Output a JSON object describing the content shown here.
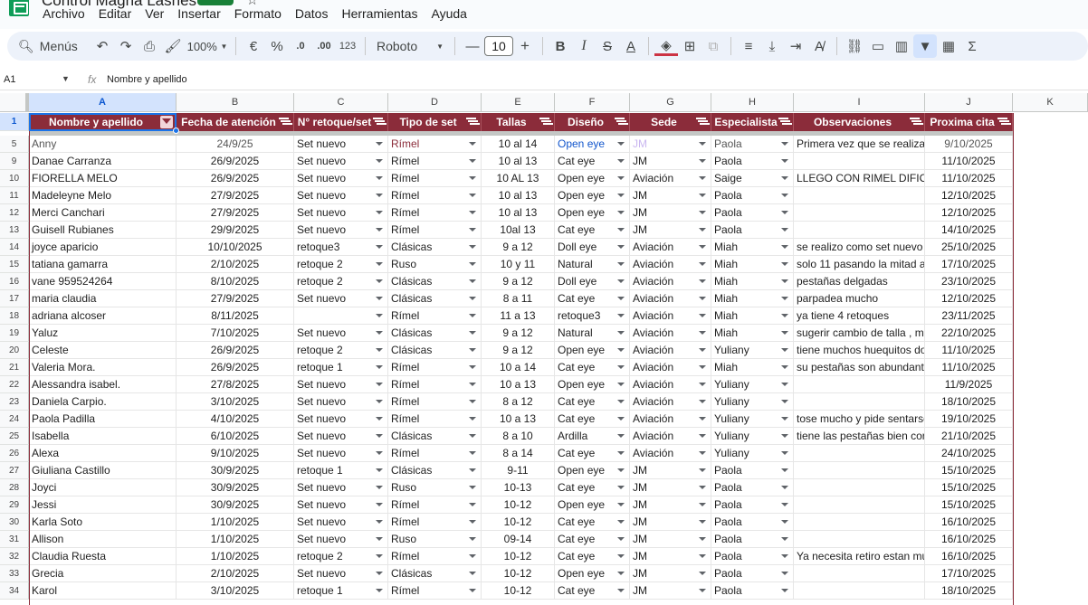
{
  "app": {
    "title": "Control Magna Lashes",
    "menu": [
      "Archivo",
      "Editar",
      "Ver",
      "Insertar",
      "Formato",
      "Datos",
      "Herramientas",
      "Ayuda"
    ]
  },
  "toolbar": {
    "search_label": "Menús",
    "zoom": "100%",
    "currency": "€",
    "percent": "%",
    "dec_decrease": ".0",
    "dec_increase": ".00",
    "number_format": "123",
    "font": "Roboto",
    "font_size": "10",
    "minus": "—",
    "plus": "+"
  },
  "formula_bar": {
    "cell_ref": "A1",
    "fx": "fx",
    "content": "Nombre y apellido"
  },
  "columns": [
    {
      "letter": "A",
      "header": "Nombre y apellido",
      "filter_active": true
    },
    {
      "letter": "B",
      "header": "Fecha de atención",
      "filter_active": false
    },
    {
      "letter": "C",
      "header": "N° retoque/set",
      "filter_active": false
    },
    {
      "letter": "D",
      "header": "Tipo de set",
      "filter_active": false
    },
    {
      "letter": "E",
      "header": "Tallas",
      "filter_active": false
    },
    {
      "letter": "F",
      "header": "Diseño",
      "filter_active": false
    },
    {
      "letter": "G",
      "header": "Sede",
      "filter_active": false
    },
    {
      "letter": "H",
      "header": "Especialista",
      "filter_active": false
    },
    {
      "letter": "I",
      "header": "Observaciones",
      "filter_active": false
    },
    {
      "letter": "J",
      "header": "Proxima cita",
      "filter_active": false
    },
    {
      "letter": "K",
      "header": "",
      "filter_active": false
    }
  ],
  "header_row_number": "1",
  "rows": [
    {
      "n": "5",
      "cells": [
        "Anny",
        "24/9/25",
        "Set nuevo",
        "Rímel",
        "10 al 14",
        "Open eye",
        "JM",
        "Paola",
        "Primera vez que se realiza",
        "9/10/2025"
      ]
    },
    {
      "n": "9",
      "cells": [
        "Danae Carranza",
        "26/9/2025",
        "Set nuevo",
        "Rímel",
        "10 al 13",
        "Cat eye",
        "JM",
        "Paola",
        "",
        "11/10/2025"
      ]
    },
    {
      "n": "10",
      "cells": [
        "FIORELLA MELO",
        "26/9/2025",
        "Set nuevo",
        "Rímel",
        "10 AL 13",
        "Open eye",
        "Aviación",
        "Saige",
        "LLEGO CON RIMEL DIFIC",
        "11/10/2025"
      ]
    },
    {
      "n": "11",
      "cells": [
        "Madeleyne Melo",
        "27/9/2025",
        "Set nuevo",
        "Rímel",
        "10 al 13",
        "Open eye",
        "JM",
        "Paola",
        "",
        "12/10/2025"
      ]
    },
    {
      "n": "12",
      "cells": [
        "Merci Canchari",
        "27/9/2025",
        "Set nuevo",
        "Rímel",
        "10 al 13",
        "Open eye",
        "JM",
        "Paola",
        "",
        "12/10/2025"
      ]
    },
    {
      "n": "13",
      "cells": [
        "Guisell Rubianes",
        "29/9/2025",
        "Set nuevo",
        "Rímel",
        "10al 13",
        "Cat eye",
        "JM",
        "Paola",
        "",
        "14/10/2025"
      ]
    },
    {
      "n": "14",
      "cells": [
        "joyce aparicio",
        "10/10/2025",
        "retoque3",
        "Clásicas",
        "9 a 12",
        "Doll eye",
        "Aviación",
        "Miah",
        "se realizo como set nuevo",
        "25/10/2025"
      ]
    },
    {
      "n": "15",
      "cells": [
        "tatiana gamarra",
        "2/10/2025",
        "retoque 2",
        "Ruso",
        "10 y 11",
        "Natural",
        "Aviación",
        "Miah",
        "solo 11 pasando la mitad a",
        "17/10/2025"
      ]
    },
    {
      "n": "16",
      "cells": [
        "vane 959524264",
        "8/10/2025",
        "retoque 2",
        "Clásicas",
        "9 a 12",
        "Doll eye",
        "Aviación",
        "Miah",
        "pestañas delgadas",
        "23/10/2025"
      ]
    },
    {
      "n": "17",
      "cells": [
        "maria claudia",
        "27/9/2025",
        "Set nuevo",
        "Clásicas",
        "8 a 11",
        "Cat eye",
        "Aviación",
        "Miah",
        "parpadea mucho",
        "12/10/2025"
      ]
    },
    {
      "n": "18",
      "cells": [
        "adriana alcoser",
        "8/11/2025",
        "",
        "Rímel",
        "11 a 13",
        "retoque3",
        "Aviación",
        "Miah",
        "ya tiene 4 retoques",
        "23/11/2025"
      ]
    },
    {
      "n": "19",
      "cells": [
        "Yaluz",
        "7/10/2025",
        "Set nuevo",
        "Clásicas",
        "9 a 12",
        "Natural",
        "Aviación",
        "Miah",
        "sugerir cambio de talla , m",
        "22/10/2025"
      ]
    },
    {
      "n": "20",
      "cells": [
        "Celeste",
        "26/9/2025",
        "retoque 2",
        "Clásicas",
        "9 a 12",
        "Open eye",
        "Aviación",
        "Yuliany",
        "tiene muchos huequitos do",
        "11/10/2025"
      ]
    },
    {
      "n": "21",
      "cells": [
        "Valeria Mora.",
        "26/9/2025",
        "retoque 1",
        "Rímel",
        "10 a 14",
        "Cat eye",
        "Aviación",
        "Miah",
        "su pestañas son abundante",
        "11/10/2025"
      ]
    },
    {
      "n": "22",
      "cells": [
        "Alessandra isabel.",
        "27/8/2025",
        "Set nuevo",
        "Rímel",
        "10 a 13",
        "Open eye",
        "Aviación",
        "Yuliany",
        "",
        "11/9/2025"
      ]
    },
    {
      "n": "23",
      "cells": [
        "Daniela Carpio.",
        "3/10/2025",
        "Set nuevo",
        "Rímel",
        "8 a 12",
        "Cat eye",
        "Aviación",
        "Yuliany",
        "",
        "18/10/2025"
      ]
    },
    {
      "n": "24",
      "cells": [
        "Paola Padilla",
        "4/10/2025",
        "Set nuevo",
        "Rímel",
        "10 a 13",
        "Cat eye",
        "Aviación",
        "Yuliany",
        "tose mucho y pide sentarse",
        "19/10/2025"
      ]
    },
    {
      "n": "25",
      "cells": [
        "Isabella",
        "6/10/2025",
        "Set nuevo",
        "Clásicas",
        "8 a 10",
        "Ardilla",
        "Aviación",
        "Yuliany",
        "tiene las pestañas bien cor",
        "21/10/2025"
      ]
    },
    {
      "n": "26",
      "cells": [
        "Alexa",
        "9/10/2025",
        "Set nuevo",
        "Rímel",
        "8 a 14",
        "Cat eye",
        "Aviación",
        "Yuliany",
        "",
        "24/10/2025"
      ]
    },
    {
      "n": "27",
      "cells": [
        "Giuliana Castillo",
        "30/9/2025",
        "retoque 1",
        "Clásicas",
        "9-11",
        "Open eye",
        "JM",
        "Paola",
        "",
        "15/10/2025"
      ]
    },
    {
      "n": "28",
      "cells": [
        "Joyci",
        "30/9/2025",
        "Set nuevo",
        "Ruso",
        "10-13",
        "Cat eye",
        "JM",
        "Paola",
        "",
        "15/10/2025"
      ]
    },
    {
      "n": "29",
      "cells": [
        "Jessi",
        "30/9/2025",
        "Set nuevo",
        "Rímel",
        "10-12",
        "Open eye",
        "JM",
        "Paola",
        "",
        "15/10/2025"
      ]
    },
    {
      "n": "30",
      "cells": [
        "Karla Soto",
        "1/10/2025",
        "Set nuevo",
        "Rímel",
        "10-12",
        "Cat eye",
        "JM",
        "Paola",
        "",
        "16/10/2025"
      ]
    },
    {
      "n": "31",
      "cells": [
        "Allison",
        "1/10/2025",
        "Set nuevo",
        "Ruso",
        "09-14",
        "Cat eye",
        "JM",
        "Paola",
        "",
        "16/10/2025"
      ]
    },
    {
      "n": "32",
      "cells": [
        "Claudia Ruesta",
        "1/10/2025",
        "retoque 2",
        "Rímel",
        "10-12",
        "Cat eye",
        "JM",
        "Paola",
        "Ya necesita retiro estan mu",
        "16/10/2025"
      ]
    },
    {
      "n": "33",
      "cells": [
        "Grecia",
        "2/10/2025",
        "Set nuevo",
        "Clásicas",
        "10-12",
        "Open eye",
        "JM",
        "Paola",
        "",
        "17/10/2025"
      ]
    },
    {
      "n": "34",
      "cells": [
        "Karol",
        "3/10/2025",
        "retoque 1",
        "Rímel",
        "10-12",
        "Cat eye",
        "JM",
        "Paola",
        "",
        "18/10/2025"
      ]
    }
  ],
  "colors": {
    "header_bg": "#8b2c3a",
    "selection": "#1a73e8",
    "sheets_green": "#0f9d58"
  }
}
